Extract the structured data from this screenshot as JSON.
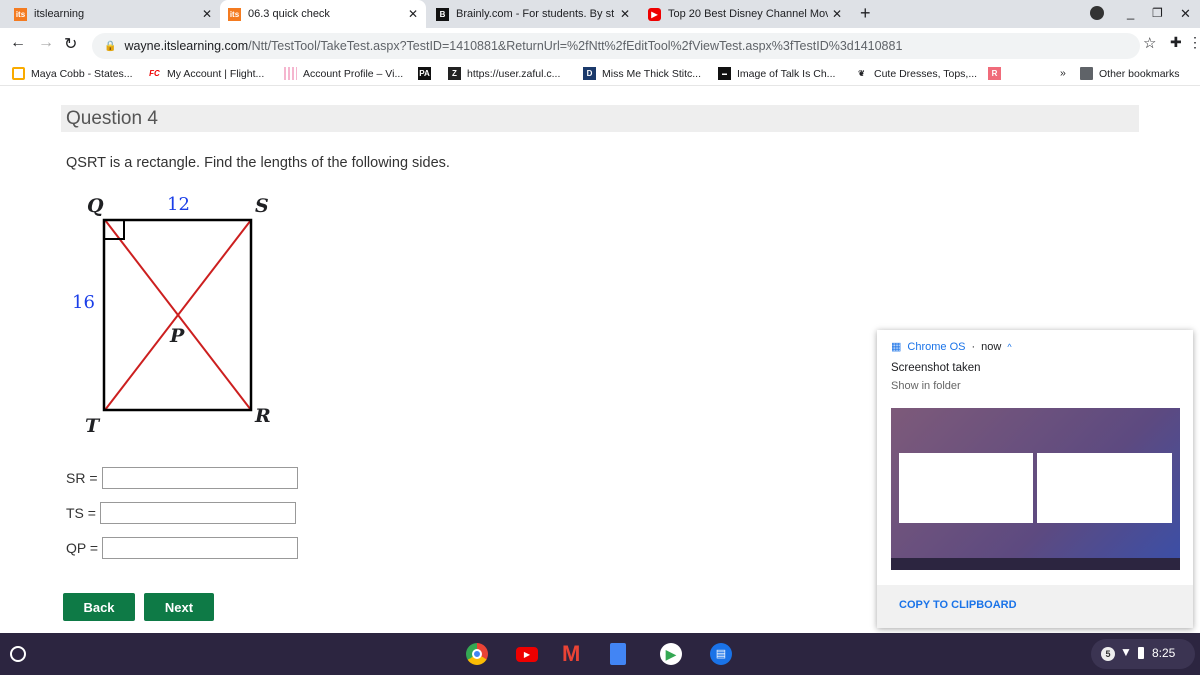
{
  "browser": {
    "tabs": [
      {
        "title": "itslearning",
        "icon": "its-icon",
        "active": false
      },
      {
        "title": "06.3 quick check",
        "icon": "its-icon",
        "active": true
      },
      {
        "title": "Brainly.com - For students. By st",
        "icon": "brainly-icon",
        "active": false
      },
      {
        "title": "Top 20 Best Disney Channel Mov",
        "icon": "youtube-icon",
        "active": false
      }
    ],
    "url_host": "wayne.itslearning.com",
    "url_path": "/Ntt/TestTool/TakeTest.aspx?TestID=1410881&ReturnUrl=%2fNtt%2fEditTool%2fViewTest.aspx%3fTestID%3d1410881",
    "bookmarks": [
      "Maya Cobb - States...",
      "My Account | Flight...",
      "Account Profile – Vi...",
      "",
      "https://user.zaful.c...",
      "Miss Me Thick Stitc...",
      "Image of Talk Is Ch...",
      "Cute Dresses, Tops,...",
      ""
    ],
    "other_bookmarks": "Other bookmarks"
  },
  "question": {
    "header": "Question 4",
    "prompt": "QSRT is a rectangle. Find the lengths of the following sides.",
    "diagram": {
      "Q": "Q",
      "S": "S",
      "T": "T",
      "R": "R",
      "P": "P",
      "top_length": "12",
      "left_length": "16",
      "line_color": "#cc1f1f",
      "label_color": "#1a3ee8"
    },
    "fields": [
      {
        "label": "SR =",
        "value": ""
      },
      {
        "label": "TS =",
        "value": ""
      },
      {
        "label": "QP =",
        "value": ""
      }
    ],
    "back": "Back",
    "next": "Next"
  },
  "notification": {
    "source": "Chrome OS",
    "time": "now",
    "title": "Screenshot taken",
    "subtitle": "Show in folder",
    "action": "COPY TO CLIPBOARD"
  },
  "shelf": {
    "notif_count": "5",
    "time": "8:25"
  }
}
